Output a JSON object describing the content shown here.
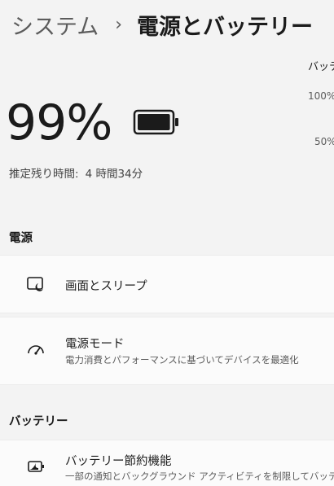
{
  "breadcrumb": {
    "parent": "システム",
    "separator": "›",
    "current": "電源とバッテリー"
  },
  "battery": {
    "percent_text": "99%",
    "level_percent": 99,
    "remaining_label": "推定残り時間:",
    "remaining_value": "4 時間34分"
  },
  "usage_chart": {
    "label": "バッテ",
    "tick_100": "100%",
    "tick_50": "50%"
  },
  "sections": {
    "power": "電源",
    "battery": "バッテリー"
  },
  "items": {
    "screen_sleep": {
      "title": "画面とスリープ",
      "icon": "display-sleep-icon"
    },
    "power_mode": {
      "title": "電源モード",
      "subtitle": "電力消費とパフォーマンスに基づいてデバイスを最適化",
      "icon": "speedometer-icon"
    },
    "battery_saver": {
      "title": "バッテリー節約機能",
      "subtitle": "一部の通知とバックグラウンド アクティビティを制限してバッテリ",
      "icon": "battery-saver-icon"
    }
  },
  "colors": {
    "background": "#f3f3f3",
    "card": "#fbfbfb",
    "text": "#1b1b1b",
    "secondary_text": "#5c5c5c"
  }
}
